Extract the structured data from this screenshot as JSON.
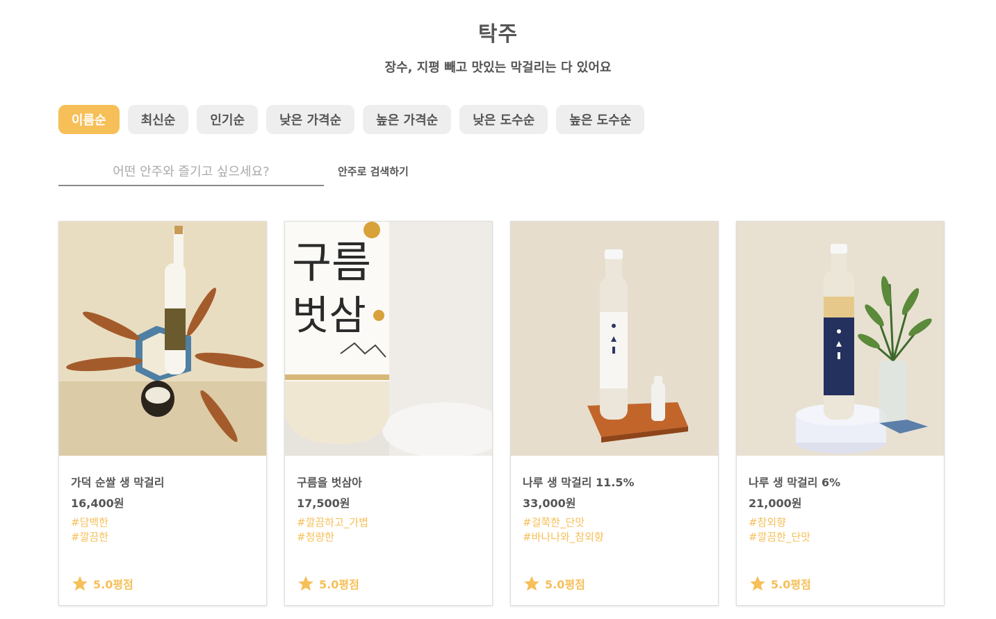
{
  "page": {
    "title": "탁주",
    "subtitle": "장수, 지평 빼고 맛있는 막걸리는 다 있어요"
  },
  "sort_options": [
    "이름순",
    "최신순",
    "인기순",
    "낮은 가격순",
    "높은 가격순",
    "낮은 도수순",
    "높은 도수순"
  ],
  "sort_selected": "이름순",
  "search": {
    "placeholder": "어떤 안주와 즐기고 싶으세요?",
    "button_label": "안주로 검색하기"
  },
  "colors": {
    "accent": "#f6bf58",
    "chip_bg": "#eeeeee",
    "text": "#555555"
  },
  "products": [
    {
      "name": "가덕 순쌀 생 막걸리",
      "price": "16,400원",
      "tags": [
        "#담백한",
        "#깔끔한"
      ],
      "rating": "5.0평점",
      "icon": "star-icon"
    },
    {
      "name": "구름을 벗삼아",
      "price": "17,500원",
      "tags": [
        "#깔끔하고_가볍",
        "#청량한"
      ],
      "rating": "5.0평점",
      "icon": "star-icon"
    },
    {
      "name": "나루 생 막걸리 11.5%",
      "price": "33,000원",
      "tags": [
        "#걸쭉한_단맛",
        "#바나나와_참외향"
      ],
      "rating": "5.0평점",
      "icon": "star-icon"
    },
    {
      "name": "나루 생 막걸리 6%",
      "price": "21,000원",
      "tags": [
        "#참외향",
        "#깔끔한_단맛"
      ],
      "rating": "5.0평점",
      "icon": "star-icon"
    }
  ]
}
